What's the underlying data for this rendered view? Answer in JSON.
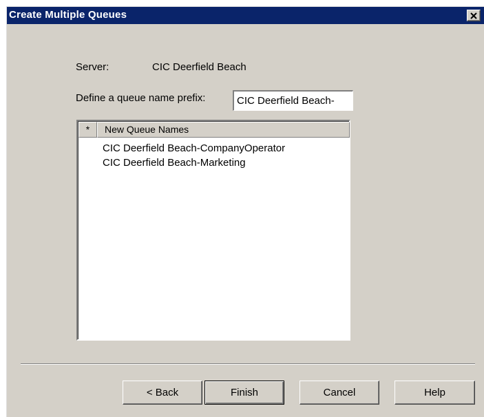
{
  "dialog": {
    "title": "Create Multiple Queues"
  },
  "server": {
    "label": "Server:",
    "value": "CIC Deerfield Beach"
  },
  "prefix": {
    "label": "Define a queue name prefix:",
    "value": "CIC Deerfield Beach-"
  },
  "queue_list": {
    "columns": [
      "*",
      "New Queue Names"
    ],
    "rows": [
      "CIC Deerfield Beach-CompanyOperator",
      "CIC Deerfield Beach-Marketing"
    ]
  },
  "buttons": {
    "back": "< Back",
    "finish": "Finish",
    "cancel": "Cancel",
    "help": "Help"
  }
}
